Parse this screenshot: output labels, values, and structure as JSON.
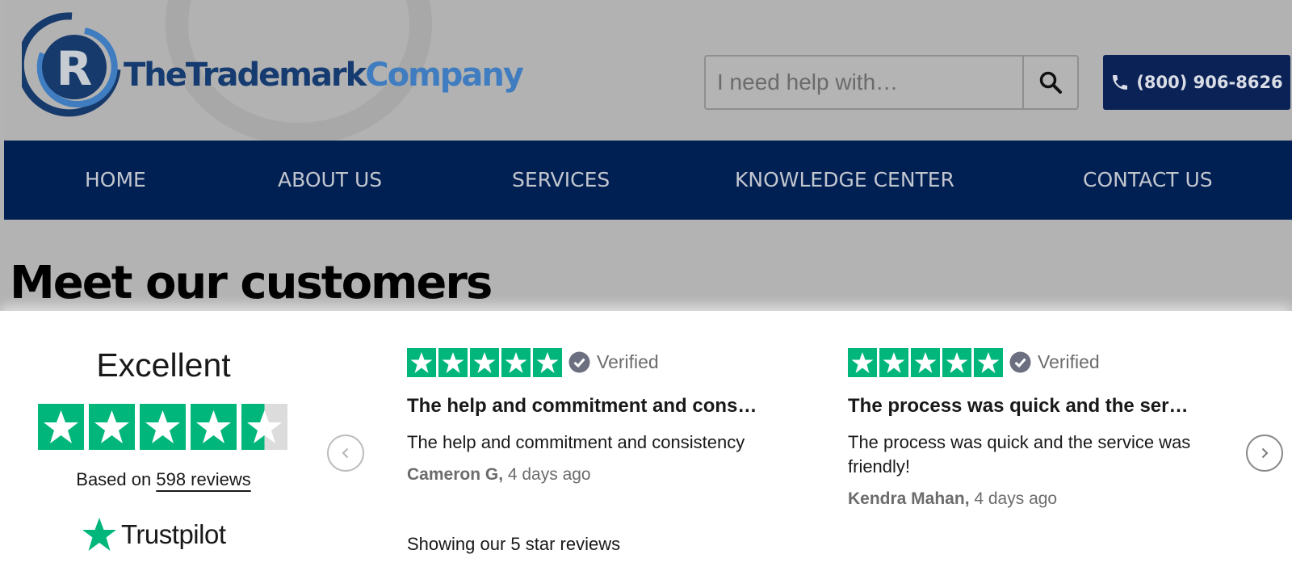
{
  "logo": {
    "part1": "TheTrademark",
    "part2": "Company"
  },
  "search": {
    "placeholder": "I need help with…"
  },
  "phone": {
    "label": "(800) 906-8626"
  },
  "nav": [
    {
      "label": "HOME"
    },
    {
      "label": "ABOUT US"
    },
    {
      "label": "SERVICES"
    },
    {
      "label": "KNOWLEDGE CENTER"
    },
    {
      "label": "CONTACT US"
    }
  ],
  "page_title": "Meet our customers",
  "summary": {
    "rating_text": "Excellent",
    "stars": 4.5,
    "based_prefix": "Based on ",
    "reviews_link": "598 reviews",
    "brand": "Trustpilot"
  },
  "reviews": [
    {
      "stars": 5,
      "verified": "Verified",
      "title": "The help and commitment and cons…",
      "body": "The help and commitment and consistency",
      "author": "Cameron G,",
      "date": " 4 days ago"
    },
    {
      "stars": 5,
      "verified": "Verified",
      "title": "The process was quick and the ser…",
      "body": "The process was quick and the service was friendly!",
      "author": "Kendra Mahan,",
      "date": " 4 days ago"
    }
  ],
  "footer_note": "Showing our 5 star reviews",
  "colors": {
    "navy": "#001f52",
    "trustpilot_green": "#00b67a",
    "star_empty": "#dcdcdc"
  }
}
